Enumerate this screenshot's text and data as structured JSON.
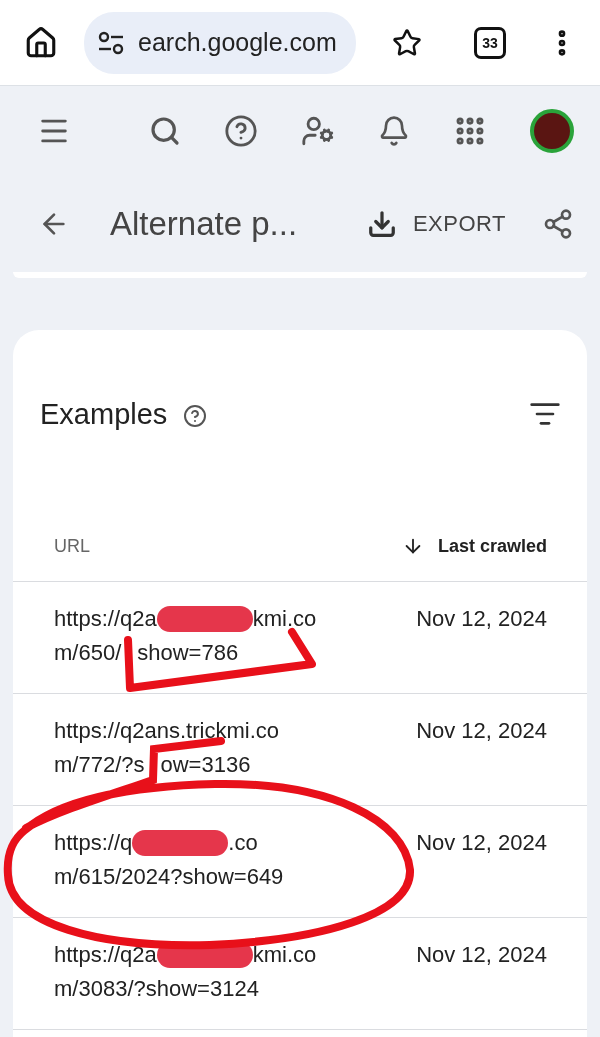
{
  "browser": {
    "url": "earch.google.com",
    "tab_count": "33"
  },
  "header": {
    "title": "Alternate p...",
    "export_label": "EXPORT"
  },
  "card": {
    "title": "Examples",
    "columns": [
      {
        "label": "URL",
        "sorted": false
      },
      {
        "label": "Last crawled",
        "sorted": true
      }
    ],
    "rows": [
      {
        "url_lines": [
          [
            {
              "kind": "text",
              "text": "https://q2a"
            },
            {
              "kind": "blob"
            },
            {
              "kind": "text",
              "text": "kmi.co"
            }
          ],
          [
            {
              "kind": "text",
              "text": "m/650/"
            },
            {
              "kind": "hidden"
            },
            {
              "kind": "text",
              "text": "show=786"
            }
          ]
        ],
        "date": "Nov 12, 2024"
      },
      {
        "url_lines": [
          [
            {
              "kind": "text",
              "text": "https://q2ans.trickmi.co"
            }
          ],
          [
            {
              "kind": "text",
              "text": "m/772/?s"
            },
            {
              "kind": "hidden"
            },
            {
              "kind": "text",
              "text": "ow=3136"
            }
          ]
        ],
        "date": "Nov 12, 2024"
      },
      {
        "url_lines": [
          [
            {
              "kind": "text",
              "text": "https://q"
            },
            {
              "kind": "blob"
            },
            {
              "kind": "text",
              "text": ".co"
            }
          ],
          [
            {
              "kind": "text",
              "text": "m/615/2024?show=649"
            }
          ]
        ],
        "date": "Nov 12, 2024"
      },
      {
        "url_lines": [
          [
            {
              "kind": "text",
              "text": "https://q2a"
            },
            {
              "kind": "blob"
            },
            {
              "kind": "text",
              "text": "kmi.co"
            }
          ],
          [
            {
              "kind": "text",
              "text": "m/3083/?show=3124"
            }
          ]
        ],
        "date": "Nov 12, 2024"
      }
    ]
  }
}
